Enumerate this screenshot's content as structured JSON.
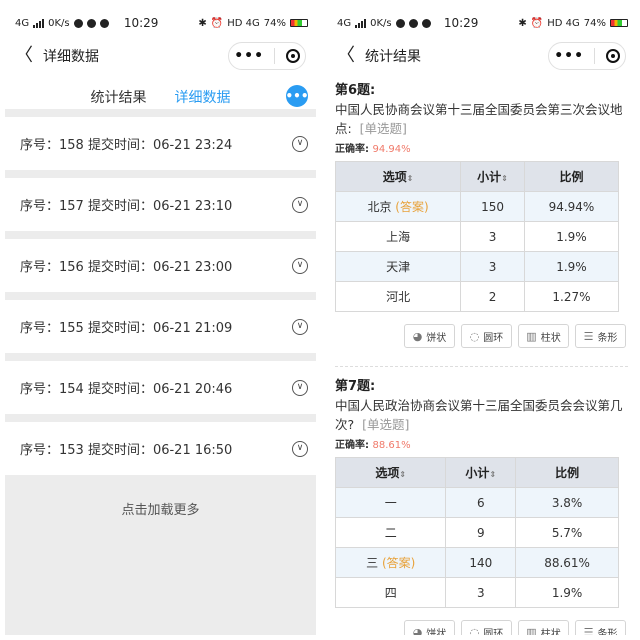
{
  "status_left": {
    "network": "4G",
    "speed": "0K/s",
    "time": "10:29",
    "right_label": "HD 4G",
    "battery": "74%"
  },
  "status_right": {
    "network": "4G",
    "speed": "0K/s",
    "time": "10:29",
    "right_label": "HD 4G",
    "battery": "74%"
  },
  "left": {
    "nav_title": "详细数据",
    "tabs": [
      "统计结果",
      "详细数据"
    ],
    "active_tab": "详细数据",
    "fab_label": "•••",
    "rows": [
      {
        "label": "序号：158  提交时间：06-21 23:24"
      },
      {
        "label": "序号：157  提交时间：06-21 23:10"
      },
      {
        "label": "序号：156  提交时间：06-21 23:00"
      },
      {
        "label": "序号：155  提交时间：06-21 21:09"
      },
      {
        "label": "序号：154  提交时间：06-21 20:46"
      },
      {
        "label": "序号：153  提交时间：06-21 16:50"
      }
    ],
    "load_more": "点击加载更多"
  },
  "right": {
    "nav_title": "统计结果",
    "q6": {
      "title": "第6题:",
      "text": "中国人民协商会议第十三届全国委员会第三次会议地点:",
      "type": "[单选题]",
      "rate_label": "正确率:",
      "rate_value": "94.94%",
      "headers": [
        "选项",
        "小计",
        "比例"
      ],
      "rows": [
        {
          "option": "北京",
          "answer": "(答案)",
          "count": "150",
          "ratio": "94.94%"
        },
        {
          "option": "上海",
          "answer": "",
          "count": "3",
          "ratio": "1.9%"
        },
        {
          "option": "天津",
          "answer": "",
          "count": "3",
          "ratio": "1.9%"
        },
        {
          "option": "河北",
          "answer": "",
          "count": "2",
          "ratio": "1.27%"
        }
      ],
      "buttons": [
        "饼状",
        "圆环",
        "柱状",
        "条形"
      ]
    },
    "q7": {
      "title": "第7题:",
      "text": "中国人民政治协商会议第十三届全国委员会会议第几次?",
      "type": "[单选题]",
      "rate_label": "正确率:",
      "rate_value": "88.61%",
      "headers": [
        "选项",
        "小计",
        "比例"
      ],
      "rows": [
        {
          "option": "一",
          "answer": "",
          "count": "6",
          "ratio": "3.8%"
        },
        {
          "option": "二",
          "answer": "",
          "count": "9",
          "ratio": "5.7%"
        },
        {
          "option": "三",
          "answer": "(答案)",
          "count": "140",
          "ratio": "88.61%"
        },
        {
          "option": "四",
          "answer": "",
          "count": "3",
          "ratio": "1.9%"
        }
      ],
      "buttons": [
        "饼状",
        "圆环",
        "柱状",
        "条形"
      ]
    }
  }
}
